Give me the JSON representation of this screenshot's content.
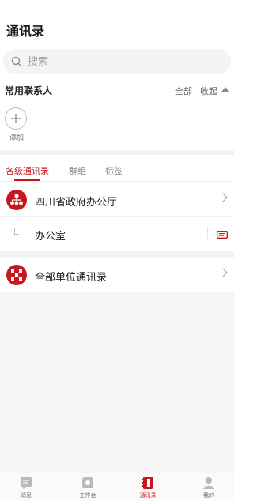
{
  "header": {
    "title": "通讯录"
  },
  "search": {
    "placeholder": "搜索",
    "icon": "search-icon"
  },
  "favorites": {
    "title": "常用联系人",
    "all_label": "全部",
    "collapse_label": "收起",
    "add_label": "添加"
  },
  "tabs": [
    {
      "label": "各级通讯录",
      "active": true
    },
    {
      "label": "群组",
      "active": false
    },
    {
      "label": "标签",
      "active": false
    }
  ],
  "org_list": {
    "root": {
      "label": "四川省政府办公厅",
      "icon": "org-tree-icon"
    },
    "child": {
      "label": "办公室",
      "icon": "chat-icon"
    },
    "all_units": {
      "label": "全部单位通讯录",
      "icon": "network-icon"
    }
  },
  "bottom_nav": [
    {
      "label": "消息",
      "icon": "message-icon",
      "active": false
    },
    {
      "label": "工作台",
      "icon": "workbench-icon",
      "active": false
    },
    {
      "label": "通讯录",
      "icon": "contacts-icon",
      "active": true
    },
    {
      "label": "我的",
      "icon": "profile-icon",
      "active": false
    }
  ],
  "colors": {
    "accent": "#c8161e",
    "band": "#f3f3f5",
    "muted": "#8c8c8c"
  }
}
